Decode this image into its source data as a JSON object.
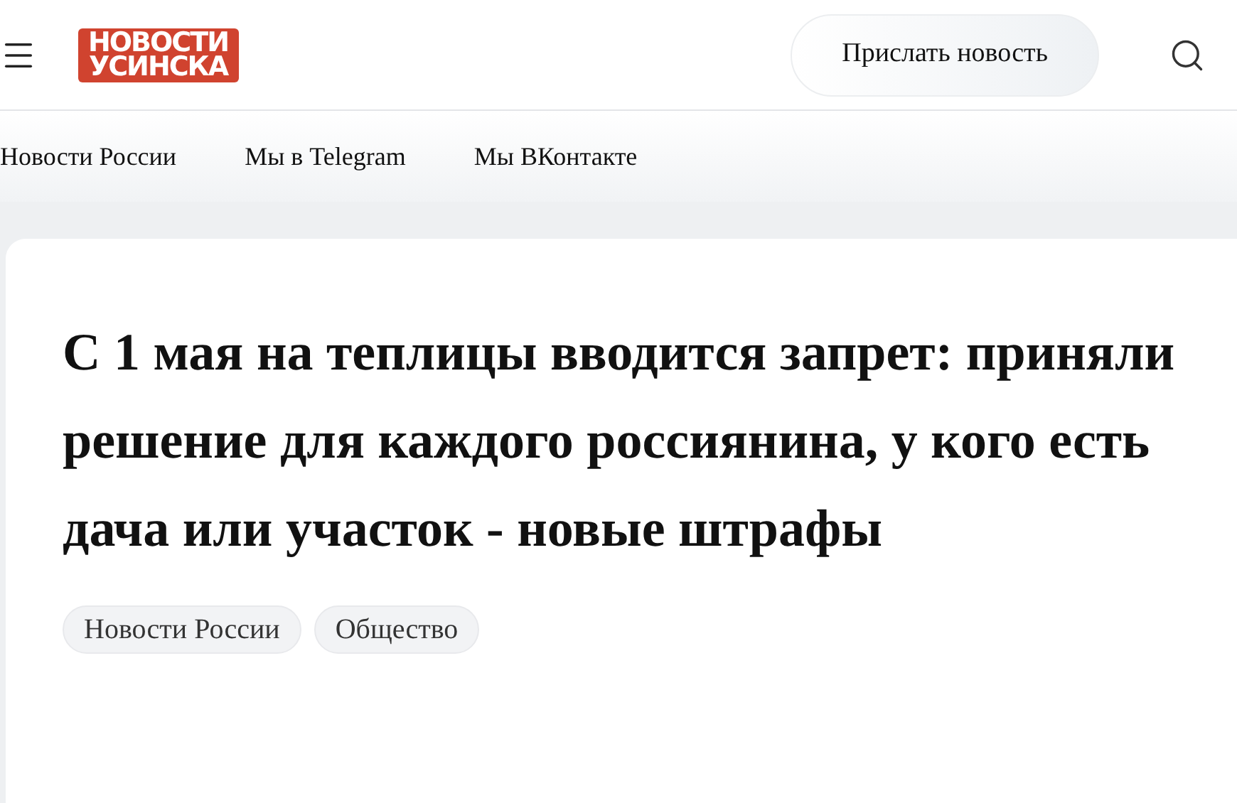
{
  "header": {
    "logo": [
      "НОВОСТИ",
      "УСИНСКА"
    ],
    "submit_button": "Прислать новость"
  },
  "nav": [
    "Новости России",
    "Мы в Telegram",
    "Мы ВКонтакте"
  ],
  "article": {
    "title": "С 1 мая на теплицы вводится запрет: приняли решение для каждого россиянина, у кого есть дача или участок - новые штрафы",
    "tags": [
      "Новости России",
      "Общество"
    ]
  }
}
